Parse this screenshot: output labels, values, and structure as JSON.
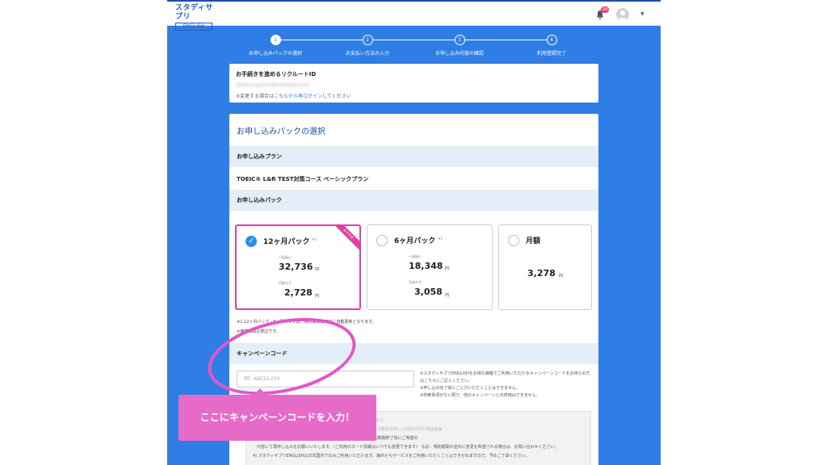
{
  "app": {
    "logo_main": "スタディサプリ",
    "logo_sub": "ENGLISH",
    "notification_count": "34"
  },
  "steps": [
    {
      "number": "1",
      "label": "お申し込みパックの選択"
    },
    {
      "number": "2",
      "label": "お支払い方法の入力"
    },
    {
      "number": "3",
      "label": "お申し込み内容の確認"
    },
    {
      "number": "4",
      "label": "利用登録完了"
    }
  ],
  "recruit_id": {
    "title": "お手続きを進めるリクルートID",
    "value": "shota.sugimori@example.com",
    "note_prefix": "※変更する場合は",
    "note_link": "こちらから再ログイン",
    "note_suffix": "してください"
  },
  "main": {
    "title": "お申し込みパックの選択",
    "plan_section": "お申し込みプラン",
    "plan_name": "TOEIC® L&R TEST対策コース ベーシックプラン",
    "pack_section": "お申し込みパック",
    "packs": [
      {
        "name": "12ヶ月パック",
        "mark": "※1",
        "ribbon": "おすすめ",
        "lump_label": "一括払い",
        "lump_price": "32,736",
        "monthly_label": "月あたり",
        "monthly_price": "2,728",
        "yen": "円",
        "selected": true
      },
      {
        "name": "6ヶ月パック",
        "mark": "※1",
        "lump_label": "一括払い",
        "lump_price": "18,348",
        "monthly_label": "月あたり",
        "monthly_price": "3,058",
        "yen": "円",
        "selected": false
      },
      {
        "name": "月額",
        "price": "3,278",
        "yen": "円",
        "selected": false
      }
    ],
    "pack_note_1": "※1 12ヶ月パック・6ヶ月パックは、契約期間満了後に自動更新となります。",
    "pack_note_2": "※価格は税込表記です。",
    "campaign_section": "キャンペーンコード",
    "campaign_placeholder": "例）ABCD1234",
    "campaign_notes": [
      "※スタディサプリENGLISHをお得な価格でご利用いただけるキャンペーンコードをお持ちの方はこちらにご記入ください。",
      "※申し込み完了後にご入力いただくことはできません。",
      "※特筆事項がない限り、他のキャンペーンとの併用はできません。"
    ],
    "terms": [
      "※自動更新について。契約期間はお申し込み日を1日目として計算します。",
      "　お申し込みいただいたパックとお支払い方法で自動更新されます。自動更新停止は契約状況の確認画面",
      "　パックの変更を希望される場合、自動更新停止をしたうえで、契約期間終了後にご希望の",
      "　内容にて再申し込みをお願いいたします。（ご利用のカード情報はいつでも変更できます） なお、契約期間の途中に変更を希望される場合は、お問い合わせください。",
      "4) スタディサプリENGLISHは日本国内でのみご利用いただけます。海外からサービスをご利用いただくことはできかねますので、予めご了承ください。"
    ]
  },
  "annotation": {
    "callout_text": "ここにキャンペーンコードを入力！"
  },
  "colors": {
    "brand_blue": "#2f7ee6",
    "accent_pink": "#df3fa6"
  }
}
